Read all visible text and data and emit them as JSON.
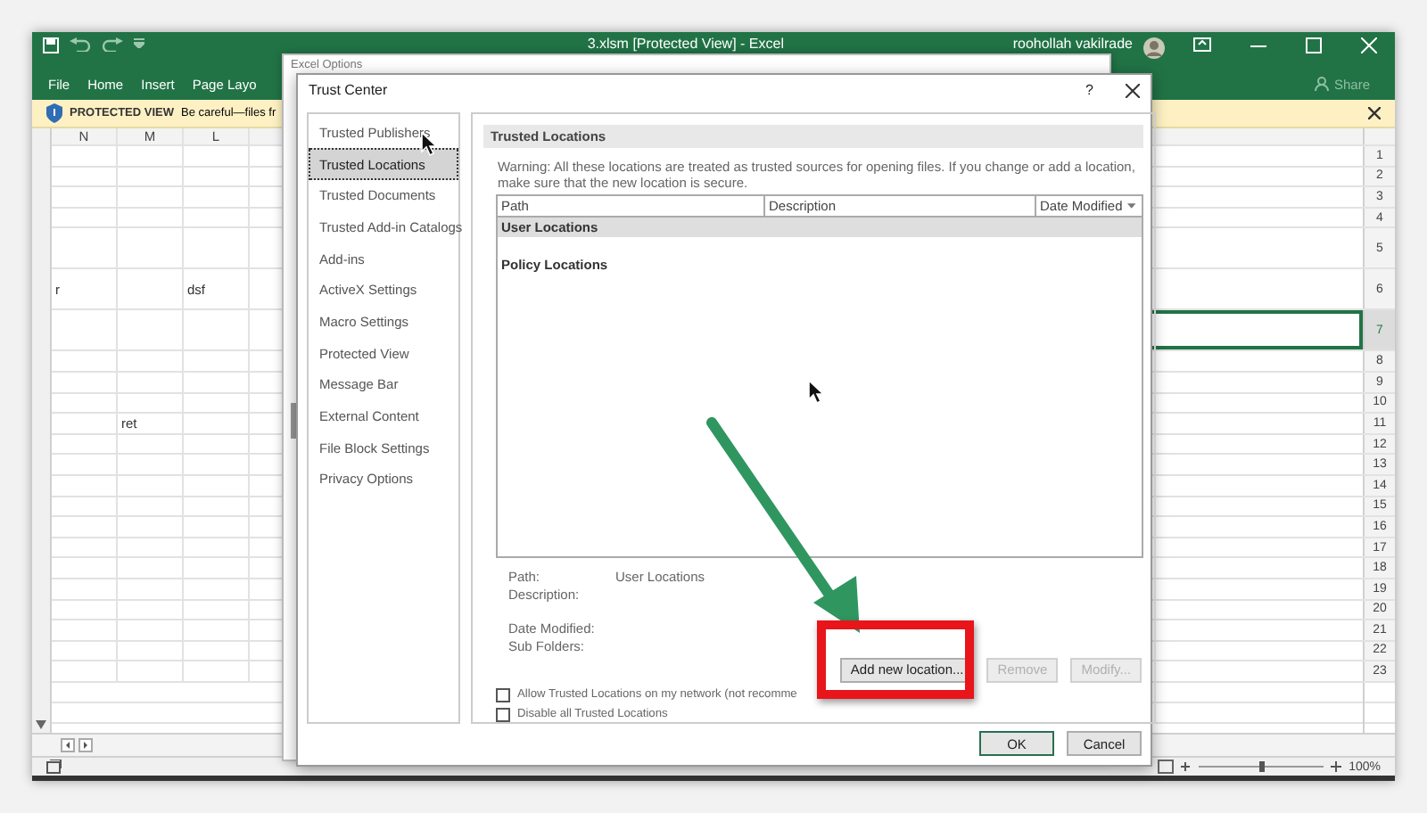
{
  "window": {
    "title": "3.xlsm  [Protected View]  -  Excel",
    "user": "roohollah vakilrade"
  },
  "ribbon": {
    "tabs": [
      {
        "label": "File",
        "selected": false
      },
      {
        "label": "Home",
        "selected": false
      },
      {
        "label": "Insert",
        "selected": false
      },
      {
        "label": "Page Layo",
        "selected": false
      }
    ],
    "share": "Share"
  },
  "message_bar": {
    "label": "PROTECTED VIEW",
    "text": "Be careful—files fr"
  },
  "sheet": {
    "columns": [
      "N",
      "M",
      "L"
    ],
    "rows": [
      {
        "number": "1",
        "tall": false,
        "selected": false
      },
      {
        "number": "2",
        "tall": false,
        "selected": false
      },
      {
        "number": "3",
        "tall": false,
        "selected": false
      },
      {
        "number": "4",
        "tall": false,
        "selected": false
      },
      {
        "number": "5",
        "tall": true,
        "selected": false
      },
      {
        "number": "6",
        "tall": true,
        "selected": false,
        "cells": [
          "r",
          null,
          "dsf"
        ]
      },
      {
        "number": "7",
        "tall": true,
        "selected": true
      },
      {
        "number": "8",
        "tall": false,
        "selected": false
      },
      {
        "number": "9",
        "tall": false,
        "selected": false
      },
      {
        "number": "10",
        "tall": false,
        "selected": false
      },
      {
        "number": "11",
        "tall": false,
        "selected": false,
        "cells": [
          null,
          "ret",
          null
        ]
      },
      {
        "number": "12",
        "tall": false,
        "selected": false
      },
      {
        "number": "13",
        "tall": false,
        "selected": false
      },
      {
        "number": "14",
        "tall": false,
        "selected": false
      },
      {
        "number": "15",
        "tall": false,
        "selected": false
      },
      {
        "number": "16",
        "tall": false,
        "selected": false
      },
      {
        "number": "17",
        "tall": false,
        "selected": false
      },
      {
        "number": "18",
        "tall": false,
        "selected": false
      },
      {
        "number": "19",
        "tall": false,
        "selected": false
      },
      {
        "number": "20",
        "tall": false,
        "selected": false
      },
      {
        "number": "21",
        "tall": false,
        "selected": false
      },
      {
        "number": "22",
        "tall": false,
        "selected": false
      },
      {
        "number": "23",
        "tall": false,
        "selected": false
      }
    ]
  },
  "status_bar": {
    "zoom": "100%"
  },
  "excel_options": {
    "title": "Excel Options"
  },
  "trust_center": {
    "title": "Trust Center",
    "help": "?",
    "nav": [
      {
        "label": "Trusted Publishers",
        "selected": false
      },
      {
        "label": "Trusted Locations",
        "selected": true
      },
      {
        "label": "Trusted Documents",
        "selected": false
      },
      {
        "label": "Trusted Add-in Catalogs",
        "selected": false
      },
      {
        "label": "Add-ins",
        "selected": false
      },
      {
        "label": "ActiveX Settings",
        "selected": false
      },
      {
        "label": "Macro Settings",
        "selected": false
      },
      {
        "label": "Protected View",
        "selected": false
      },
      {
        "label": "Message Bar",
        "selected": false
      },
      {
        "label": "External Content",
        "selected": false
      },
      {
        "label": "File Block Settings",
        "selected": false
      },
      {
        "label": "Privacy Options",
        "selected": false
      }
    ],
    "heading": "Trusted Locations",
    "warning": "Warning: All these locations are treated as trusted sources for opening files.  If you change or add a location, make sure that the new location is secure.",
    "table": {
      "columns": [
        "Path",
        "Description",
        "Date Modified"
      ],
      "groups": [
        {
          "label": "User Locations",
          "selected": true
        },
        {
          "label": "Policy Locations",
          "selected": false
        }
      ]
    },
    "details": [
      {
        "label": "Path:",
        "value": "User Locations"
      },
      {
        "label": "Description:"
      },
      {
        "label": "Date Modified:"
      },
      {
        "label": "Sub Folders:"
      }
    ],
    "buttons": [
      {
        "label": "Add new location...",
        "disabled": false
      },
      {
        "label": "Remove",
        "disabled": true
      },
      {
        "label": "Modify...",
        "disabled": true
      }
    ],
    "options": [
      {
        "label": "Allow Trusted Locations on my network (not recomme",
        "checked": false
      },
      {
        "label": "Disable all Trusted Locations",
        "checked": false
      }
    ],
    "footer": [
      {
        "label": "OK",
        "default": true
      },
      {
        "label": "Cancel",
        "default": false
      }
    ]
  }
}
